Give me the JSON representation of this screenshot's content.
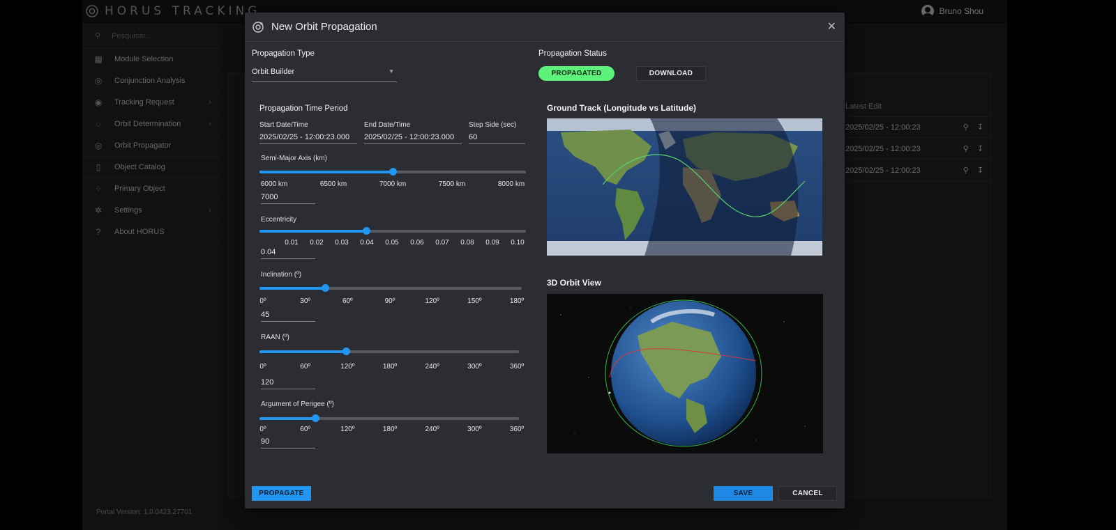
{
  "app": {
    "brand": "HORUS TRACKING",
    "user": "Bruno Shou",
    "search_placeholder": "Pesquisar...",
    "version": "Portal Version: 1.0.0423.27701"
  },
  "sidebar": {
    "items": [
      {
        "label": "Module Selection",
        "icon": "grid-icon",
        "chevron": false
      },
      {
        "label": "Conjunction Analysis",
        "icon": "radar-search-icon",
        "chevron": false
      },
      {
        "label": "Tracking Request",
        "icon": "target-icon",
        "chevron": true
      },
      {
        "label": "Orbit Determination",
        "icon": "orbit-icon",
        "chevron": true
      },
      {
        "label": "Orbit Propagator",
        "icon": "orbit-propagator-icon",
        "chevron": false
      },
      {
        "label": "Object Catalog",
        "icon": "document-icon",
        "chevron": false
      },
      {
        "label": "Primary Object",
        "icon": "primary-object-icon",
        "chevron": false
      },
      {
        "label": "Settings",
        "icon": "gear-icon",
        "chevron": true
      },
      {
        "label": "About HORUS",
        "icon": "help-icon",
        "chevron": false
      }
    ]
  },
  "background": {
    "column_header": "Latest Edit",
    "rows": [
      "2025/02/25 - 12:00:23",
      "2025/02/25 - 12:00:23",
      "2025/02/25 - 12:00:23"
    ]
  },
  "modal": {
    "title": "New Orbit Propagation",
    "propagation_type_label": "Propagation Type",
    "propagation_type_value": "Orbit Builder",
    "propagation_status_label": "Propagation Status",
    "status_badge": "PROPAGATED",
    "download_label": "DOWNLOAD",
    "time_period_label": "Propagation Time Period",
    "start_label": "Start Date/Time",
    "start_value": "2025/02/25 - 12:00:23.000",
    "end_label": "End Date/Time",
    "end_value": "2025/02/25 - 12:00:23.000",
    "step_label": "Step Side (sec)",
    "step_value": "60",
    "semi_major": {
      "label": "Semi-Major Axis (km)",
      "value": "7000",
      "ticks": [
        "6000 km",
        "6500 km",
        "7000 km",
        "7500 km",
        "8000 km"
      ],
      "level": 0.5
    },
    "eccentricity": {
      "label": "Eccentricity",
      "value": "0.04",
      "ticks": [
        "0.01",
        "0.02",
        "0.03",
        "0.04",
        "0.05",
        "0.06",
        "0.07",
        "0.08",
        "0.09",
        "0.10"
      ],
      "level": 0.4
    },
    "inclination": {
      "label": "Inclination (º)",
      "value": "45",
      "ticks": [
        "0º",
        "30º",
        "60º",
        "90º",
        "120º",
        "150º",
        "180º"
      ],
      "level": 0.25
    },
    "raan": {
      "label": "RAAN (º)",
      "value": "120",
      "ticks": [
        "0º",
        "60º",
        "120º",
        "180º",
        "240º",
        "300º",
        "360º"
      ],
      "level": 0.3333
    },
    "perigee": {
      "label": "Argument of Perigee (º)",
      "value": "90",
      "ticks": [
        "0º",
        "60º",
        "120º",
        "180º",
        "240º",
        "300º",
        "360º"
      ],
      "level": 0.2143
    },
    "ground_track_label": "Ground Track (Longitude vs Latitude)",
    "orbit_view_label": "3D Orbit View",
    "propagate_label": "PROPAGATE",
    "save_label": "SAVE",
    "cancel_label": "CANCEL"
  },
  "colors": {
    "accent": "#2196f3",
    "status_green": "#5df27a",
    "modal_bg": "#2c2d32"
  }
}
